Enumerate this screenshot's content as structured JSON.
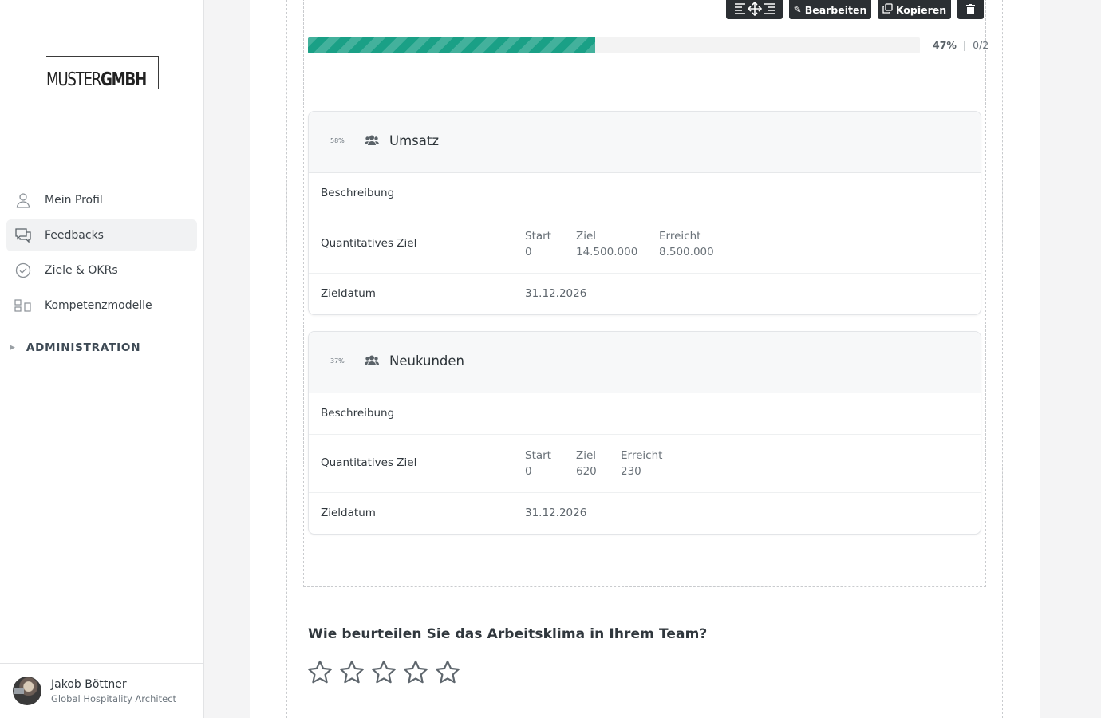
{
  "brand": {
    "logo_thin": "MUSTER",
    "logo_bold": "GMBH"
  },
  "sidebar": {
    "items": [
      {
        "label": "Mein Profil",
        "icon": "user-icon",
        "active": false
      },
      {
        "label": "Feedbacks",
        "icon": "chat-icon",
        "active": true
      },
      {
        "label": "Ziele & OKRs",
        "icon": "check-circle-icon",
        "active": false
      },
      {
        "label": "Kompetenzmodelle",
        "icon": "grid-icon",
        "active": false
      }
    ],
    "admin_label": "ADMINISTRATION",
    "user": {
      "name": "Jakob Böttner",
      "role": "Global Hospitality Architect"
    }
  },
  "toolbar": {
    "move_icon": "move-icon",
    "edit_label": "Bearbeiten",
    "copy_label": "Kopieren",
    "delete_icon": "trash-icon"
  },
  "progress": {
    "percent_label": "47%",
    "separator": "|",
    "count": "0/2",
    "value": 0.47
  },
  "goals": [
    {
      "percent": "58%",
      "title": "Umsatz",
      "description_label": "Beschreibung",
      "quant_label": "Quantitatives Ziel",
      "start_label": "Start",
      "start_value": "0",
      "target_label": "Ziel",
      "target_value": "14.500.000",
      "achieved_label": "Erreicht",
      "achieved_value": "8.500.000",
      "date_label": "Zieldatum",
      "date_value": "31.12.2026"
    },
    {
      "percent": "37%",
      "title": "Neukunden",
      "description_label": "Beschreibung",
      "quant_label": "Quantitatives Ziel",
      "start_label": "Start",
      "start_value": "0",
      "target_label": "Ziel",
      "target_value": "620",
      "achieved_label": "Erreicht",
      "achieved_value": "230",
      "date_label": "Zieldatum",
      "date_value": "31.12.2026"
    }
  ],
  "question": {
    "text": "Wie beurteilen Sie das Arbeitsklima in Ihrem Team?",
    "rating": 0,
    "max": 5
  },
  "colors": {
    "accent": "#1aa086",
    "dark_button": "#2b2f33"
  }
}
